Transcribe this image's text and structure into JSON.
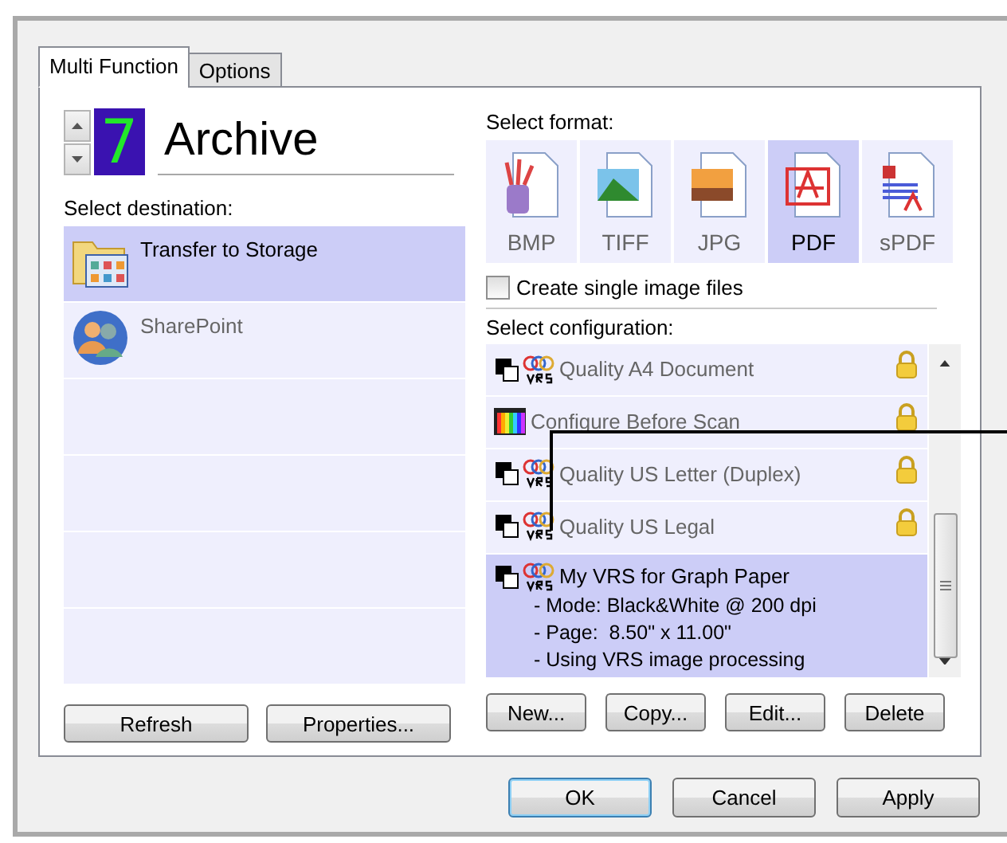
{
  "tabs": [
    {
      "label": "Multi Function",
      "selected": true
    },
    {
      "label": "Options",
      "selected": false
    }
  ],
  "profile": {
    "number": "7",
    "name": "Archive"
  },
  "destination": {
    "label": "Select destination:",
    "items": [
      {
        "name": "Transfer to Storage",
        "kind": "folder",
        "selected": true
      },
      {
        "name": "SharePoint",
        "kind": "people",
        "selected": false
      }
    ]
  },
  "destination_buttons": [
    "Refresh",
    "Properties..."
  ],
  "format": {
    "label": "Select format:",
    "items": [
      {
        "label": "BMP",
        "kind": "bmp",
        "selected": false
      },
      {
        "label": "TIFF",
        "kind": "tiff",
        "selected": false
      },
      {
        "label": "JPG",
        "kind": "jpg",
        "selected": false
      },
      {
        "label": "PDF",
        "kind": "pdf",
        "selected": true
      },
      {
        "label": "sPDF",
        "kind": "spdf",
        "selected": false
      }
    ]
  },
  "single_image": {
    "label": "Create single image files",
    "checked": false
  },
  "configuration": {
    "label": "Select configuration:",
    "items": [
      {
        "name": "Quality A4 Document",
        "kind": "vrs",
        "locked": true,
        "selected": false
      },
      {
        "name": "Configure Before Scan",
        "kind": "palette",
        "locked": true,
        "selected": false
      },
      {
        "name": "Quality US Letter (Duplex)",
        "kind": "vrs",
        "locked": true,
        "selected": false
      },
      {
        "name": "Quality US Legal",
        "kind": "vrs",
        "locked": true,
        "selected": false
      },
      {
        "name": "My VRS for Graph Paper",
        "kind": "vrs",
        "locked": false,
        "selected": true,
        "details": [
          "- Mode: Black&White @ 200 dpi",
          "- Page:  8.50\" x 11.00\"",
          "- Using VRS image processing"
        ]
      }
    ]
  },
  "configuration_buttons": [
    "New...",
    "Copy...",
    "Edit...",
    "Delete"
  ],
  "dialog_buttons": [
    {
      "label": "OK",
      "default": true
    },
    {
      "label": "Cancel",
      "default": false
    },
    {
      "label": "Apply",
      "default": false
    }
  ]
}
